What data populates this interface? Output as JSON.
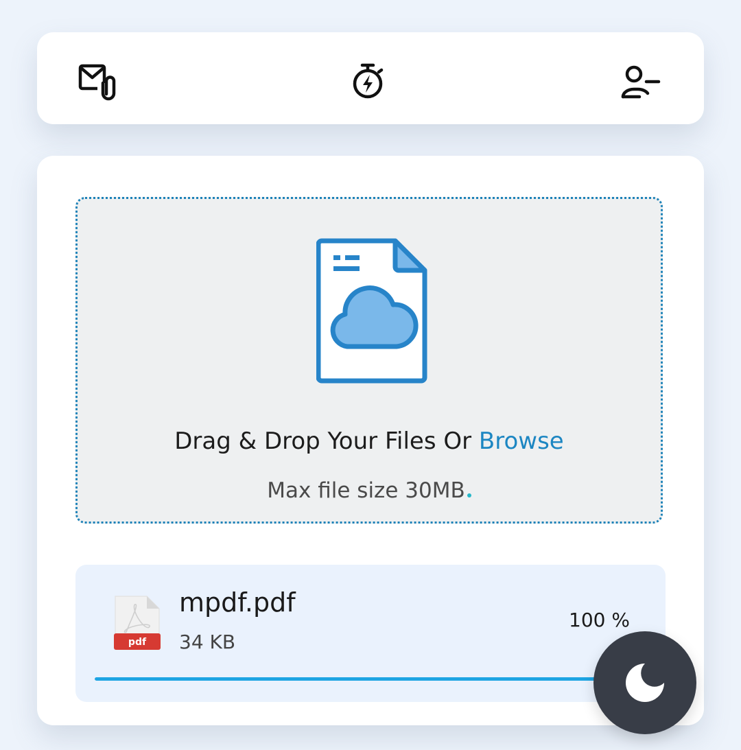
{
  "topbar": {
    "icons": [
      "mail-attachment-icon",
      "stopwatch-flash-icon",
      "user-remove-icon"
    ]
  },
  "upload": {
    "title_prefix": "Drag & Drop Your Files Or ",
    "browse_label": "Browse",
    "subtitle": "Max file size 30MB"
  },
  "file": {
    "type_label": "pdf",
    "name": "mpdf.pdf",
    "size": "34 KB",
    "progress_label": "100 %",
    "progress_percent": 100
  },
  "fab": {
    "icon": "moon-icon"
  },
  "colors": {
    "accent": "#1c86c2",
    "progress": "#1ea5e3",
    "page_bg": "#edf3fb",
    "fab_bg": "#383d47",
    "pdf_red": "#d63a32"
  }
}
